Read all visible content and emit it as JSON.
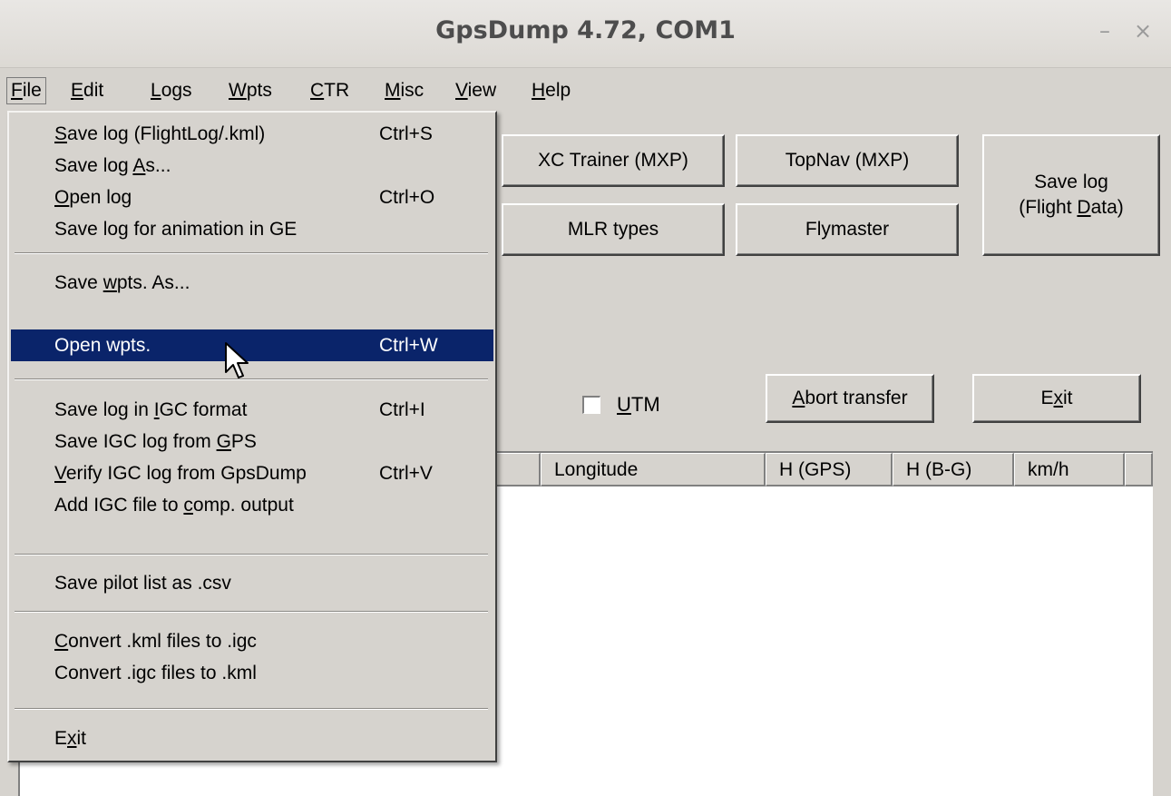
{
  "window": {
    "title": "GpsDump 4.72, COM1",
    "minimize_glyph": "–",
    "close_glyph": "×"
  },
  "menubar": [
    {
      "pre": "",
      "u": "F",
      "post": "ile"
    },
    {
      "pre": "",
      "u": "E",
      "post": "dit"
    },
    {
      "pre": "",
      "u": "L",
      "post": "ogs"
    },
    {
      "pre": "",
      "u": "W",
      "post": "pts"
    },
    {
      "pre": "",
      "u": "C",
      "post": "TR"
    },
    {
      "pre": "",
      "u": "M",
      "post": "isc"
    },
    {
      "pre": "",
      "u": "V",
      "post": "iew"
    },
    {
      "pre": "",
      "u": "H",
      "post": "elp"
    }
  ],
  "buttons": {
    "xc_trainer": "XC Trainer (MXP)",
    "topnav": "TopNav (MXP)",
    "mlr_types": "MLR types",
    "flymaster": "Flymaster",
    "save_log_line1": "Save log",
    "save_log_line2_pre": "(Flight ",
    "save_log_line2_u": "D",
    "save_log_line2_post": "ata)",
    "abort_pre": "",
    "abort_u": "A",
    "abort_post": "bort transfer",
    "exit_pre": "E",
    "exit_u": "x",
    "exit_post": "it"
  },
  "utm": {
    "pre": "",
    "u": "U",
    "post": "TM",
    "checked": false
  },
  "columns": [
    "Longitude",
    "H (GPS)",
    "H (B-G)",
    "km/h"
  ],
  "file_menu": {
    "items": [
      {
        "pre": "",
        "u": "S",
        "post": "ave log (FlightLog/.kml)",
        "shortcut": "Ctrl+S"
      },
      {
        "pre": "Save log ",
        "u": "A",
        "post": "s...",
        "shortcut": ""
      },
      {
        "pre": "",
        "u": "O",
        "post": "pen log",
        "shortcut": "Ctrl+O"
      },
      {
        "pre": "Save log for animation in GE",
        "u": "",
        "post": "",
        "shortcut": ""
      },
      {
        "pre": "Save ",
        "u": "w",
        "post": "pts. As...",
        "shortcut": ""
      },
      {
        "pre": "Open wpts.",
        "u": "",
        "post": "",
        "shortcut": "Ctrl+W"
      },
      {
        "pre": "Save log in ",
        "u": "I",
        "post": "GC format",
        "shortcut": "Ctrl+I"
      },
      {
        "pre": "Save IGC log from ",
        "u": "G",
        "post": "PS",
        "shortcut": ""
      },
      {
        "pre": "",
        "u": "V",
        "post": "erify IGC log from GpsDump",
        "shortcut": "Ctrl+V"
      },
      {
        "pre": "Add IGC file to ",
        "u": "c",
        "post": "omp. output",
        "shortcut": ""
      },
      {
        "pre": "Save pilot list as .csv",
        "u": "",
        "post": "",
        "shortcut": ""
      },
      {
        "pre": "",
        "u": "C",
        "post": "onvert .kml files to .igc",
        "shortcut": ""
      },
      {
        "pre": "Convert .igc files to .kml",
        "u": "",
        "post": "",
        "shortcut": ""
      },
      {
        "pre": "E",
        "u": "x",
        "post": "it",
        "shortcut": ""
      }
    ],
    "highlighted_index": 5
  },
  "colors": {
    "face": "#d6d3ce",
    "highlight": "#0a246a",
    "title_text": "#4d4d4d"
  }
}
